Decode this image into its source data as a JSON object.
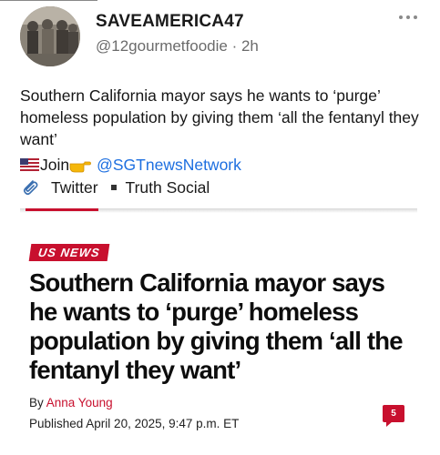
{
  "post": {
    "display_name": "SAVEAMERICA47",
    "handle": "@12gourmetfoodie",
    "separator": " · ",
    "time": "2h",
    "more_icon": "ellipsis-icon",
    "text": "Southern California mayor says he wants to ‘purge’ homeless population by giving them ‘all the fentanyl they want’",
    "join_label": "Join",
    "mention": "@SGTnewsNetwork",
    "link_1": "Twitter",
    "link_2": "Truth Social"
  },
  "card": {
    "accent_color": "#c8102e",
    "tag": "US NEWS",
    "headline": "Southern California mayor says he wants to ‘purge’ homeless population by giving them ‘all the fentanyl they want’",
    "by_prefix": "By ",
    "author": "Anna Young",
    "published": "Published April 20, 2025, 9:47 p.m. ET",
    "comment_count": "5"
  }
}
